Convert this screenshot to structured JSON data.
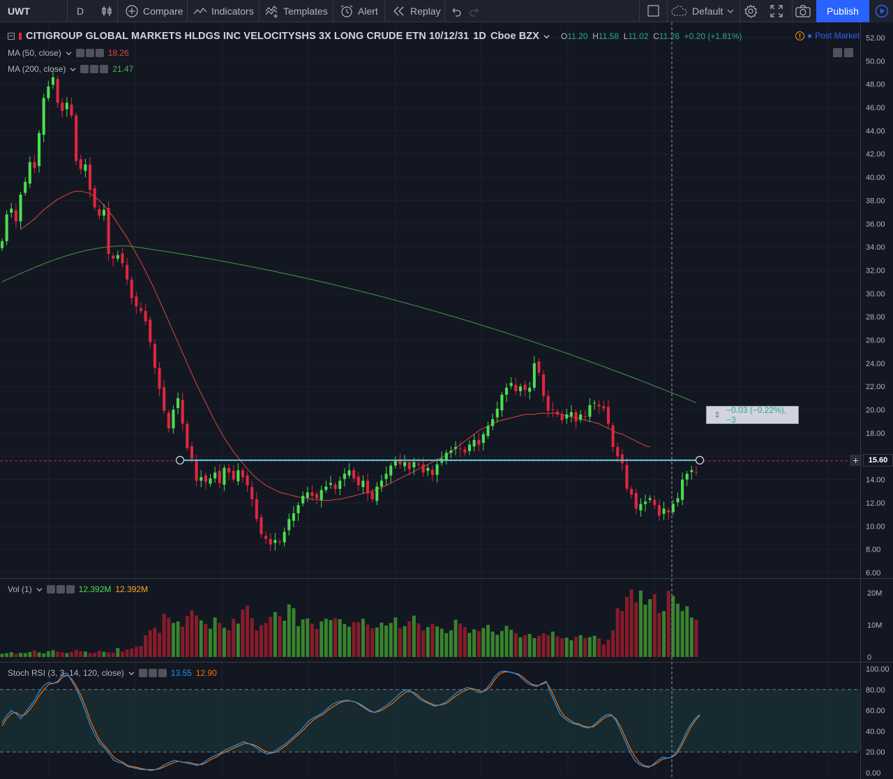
{
  "toolbar": {
    "symbol": "UWT",
    "interval": "D",
    "compare": "Compare",
    "indicators": "Indicators",
    "templates": "Templates",
    "alert": "Alert",
    "replay": "Replay",
    "layout": "Default",
    "publish": "Publish"
  },
  "main": {
    "title": "CITIGROUP GLOBAL MARKETS HLDGS INC VELOCITYSHS 3X LONG CRUDE ETN 10/12/31",
    "timeframe": "1D",
    "exchange": "Cboe BZX",
    "ohlc": {
      "o_label": "O",
      "o": "11.20",
      "h_label": "H",
      "h": "11.58",
      "l_label": "L",
      "l": "11.02",
      "c_label": "C",
      "c": "11.26",
      "change": "+0.20 (+1.81%)"
    },
    "post_market": "Post Market",
    "ma50": {
      "label": "MA (50, close)",
      "value": "18.26",
      "color": "#e0463e"
    },
    "ma200": {
      "label": "MA (200, close)",
      "value": "21.47",
      "color": "#4caf50"
    },
    "measure": "−0.03 (−0.22%), −3",
    "price_label": "15.60",
    "price_ticks": [
      "6.00",
      "8.00",
      "10.00",
      "12.00",
      "14.00",
      "16.00",
      "18.00",
      "20.00",
      "22.00",
      "24.00",
      "26.00",
      "28.00",
      "30.00",
      "32.00",
      "34.00",
      "36.00",
      "38.00",
      "40.00",
      "42.00",
      "44.00",
      "46.00",
      "48.00",
      "50.00",
      "52.00"
    ]
  },
  "volume": {
    "label": "Vol (1)",
    "v1": "12.392M",
    "v2": "12.392M",
    "ticks": [
      "0",
      "10M",
      "20M"
    ]
  },
  "stoch": {
    "label": "Stoch RSI (3, 3, 14, 120, close)",
    "k": "13.55",
    "d": "12.90",
    "ticks": [
      "0.00",
      "20.00",
      "40.00",
      "60.00",
      "80.00",
      "100.00"
    ]
  },
  "colors": {
    "up": "#26a69a",
    "up_candle": "#4ade4f",
    "down": "#e0263e",
    "k_line": "#2196f3",
    "d_line": "#ff6d00",
    "bg": "#131722"
  },
  "chart_data": {
    "type": "candlestick",
    "y_range": [
      5.5,
      53
    ],
    "closes": [
      34.5,
      36.8,
      37.3,
      36.2,
      38.5,
      39.6,
      41.3,
      40.8,
      43.8,
      46.8,
      47.8,
      48.6,
      46.4,
      45.7,
      46.4,
      45.3,
      41.4,
      40.7,
      41.1,
      38.9,
      37.4,
      36.7,
      37.2,
      33.4,
      33.0,
      33.3,
      32.6,
      31.2,
      29.6,
      28.9,
      28.5,
      27.6,
      25.8,
      23.6,
      21.8,
      19.9,
      18.4,
      20.0,
      21.0,
      18.8,
      16.7,
      15.8,
      13.9,
      14.2,
      13.8,
      14.1,
      14.6,
      13.7,
      15.0,
      14.6,
      14.0,
      14.8,
      14.2,
      13.5,
      12.3,
      10.6,
      9.3,
      8.9,
      8.4,
      8.8,
      8.6,
      9.5,
      10.6,
      11.1,
      11.8,
      12.6,
      12.9,
      12.6,
      12.4,
      13.1,
      13.4,
      13.7,
      13.2,
      13.9,
      14.5,
      14.8,
      14.1,
      13.5,
      13.9,
      12.8,
      12.3,
      13.4,
      13.9,
      14.5,
      15.2,
      15.6,
      15.3,
      15.5,
      14.9,
      15.5,
      15.3,
      14.6,
      15.0,
      14.4,
      15.3,
      15.8,
      16.3,
      16.5,
      16.8,
      16.6,
      16.3,
      17.0,
      17.4,
      17.0,
      17.9,
      18.6,
      19.2,
      20.1,
      21.3,
      21.9,
      22.3,
      21.6,
      22.0,
      21.7,
      21.9,
      24.0,
      23.2,
      21.2,
      19.9,
      20.0,
      19.6,
      19.1,
      19.6,
      19.8,
      19.0,
      19.6,
      19.4,
      20.4,
      20.6,
      20.3,
      20.1,
      18.8,
      16.8,
      16.0,
      15.4,
      13.2,
      12.7,
      11.5,
      11.9,
      12.1,
      12.4,
      11.8,
      10.9,
      11.5,
      11.2,
      11.9,
      12.4,
      14.0,
      14.5,
      14.8,
      14.6
    ],
    "ma50": [
      null,
      null,
      null,
      null,
      35.5,
      35.8,
      36.1,
      36.4,
      36.8,
      37.2,
      37.5,
      37.8,
      38.1,
      38.3,
      38.5,
      38.7,
      38.8,
      38.8,
      38.7,
      38.6,
      38.3,
      38.0,
      37.6,
      37.1,
      36.6,
      36.0,
      35.4,
      34.8,
      34.1,
      33.4,
      32.7,
      31.9,
      31.1,
      30.3,
      29.4,
      28.5,
      27.6,
      26.7,
      25.8,
      24.9,
      24.0,
      23.1,
      22.2,
      21.4,
      20.6,
      19.8,
      19.0,
      18.3,
      17.6,
      17.0,
      16.4,
      15.9,
      15.4,
      14.9,
      14.5,
      14.1,
      13.8,
      13.5,
      13.3,
      13.1,
      12.9,
      12.8,
      12.7,
      12.6,
      12.5,
      12.4,
      12.4,
      12.3,
      12.3,
      12.2,
      12.2,
      12.2,
      12.3,
      12.3,
      12.4,
      12.5,
      12.6,
      12.7,
      12.8,
      12.9,
      13.0,
      13.2,
      13.3,
      13.5,
      13.7,
      13.9,
      14.1,
      14.3,
      14.5,
      14.7,
      14.9,
      15.1,
      15.3,
      15.5,
      15.7,
      15.9,
      16.1,
      16.4,
      16.7,
      17.0,
      17.3,
      17.6,
      17.9,
      18.2,
      18.4,
      18.6,
      18.8,
      19.0,
      19.1,
      19.2,
      19.3,
      19.4,
      19.5,
      19.6,
      19.6,
      19.6,
      19.7,
      19.7,
      19.7,
      19.7,
      19.7,
      19.6,
      19.5,
      19.4,
      19.3,
      19.2,
      19.1,
      19.0,
      18.9,
      18.8,
      18.6,
      18.4,
      18.2,
      18.0,
      17.9,
      17.7,
      17.5,
      17.3,
      17.1,
      16.9,
      16.8
    ],
    "ma200_start": 31.0,
    "ma200_peak": 34.1,
    "ma200_end": 20.6,
    "volume": [
      1,
      1.2,
      1.5,
      1,
      1.3,
      1.2,
      1.5,
      2,
      1.4,
      1.1,
      1.8,
      2.1,
      1.6,
      1.4,
      1.2,
      1.5,
      2.2,
      1.8,
      1.7,
      1.2,
      1.3,
      1.9,
      1.6,
      1.4,
      1.3,
      2.8,
      1.7,
      2.3,
      2.6,
      3.1,
      3.4,
      6.8,
      8.3,
      9.1,
      7.5,
      13.5,
      12.2,
      10.6,
      11.1,
      9.4,
      12.7,
      14.5,
      12.9,
      11.4,
      10.2,
      8.8,
      12.3,
      10.6,
      9.1,
      8.3,
      11.9,
      10.4,
      14.8,
      16.0,
      12.1,
      8.3,
      9.9,
      10.6,
      12.5,
      14.0,
      12.7,
      11.3,
      16.4,
      15.2,
      9.6,
      11.7,
      12.0,
      10.4,
      8.7,
      11.1,
      11.9,
      11.5,
      12.1,
      11.8,
      10.3,
      9.4,
      10.9,
      10.8,
      11.9,
      10.1,
      8.9,
      9.2,
      10.7,
      9.8,
      10.6,
      12.3,
      9.0,
      9.6,
      11.1,
      12.9,
      10.5,
      8.2,
      9.3,
      10.3,
      9.5,
      8.8,
      7.4,
      8.3,
      11.6,
      10.4,
      9.3,
      7.5,
      8.6,
      8.1,
      9.0,
      10.0,
      7.9,
      6.9,
      8.1,
      9.7,
      8.5,
      7.4,
      6.1,
      6.8,
      7.2,
      5.9,
      6.6,
      7.4,
      6.8,
      7.9,
      6.4,
      5.8,
      6.0,
      5.2,
      6.3,
      6.8,
      5.9,
      6.2,
      6.6,
      5.8,
      3.9,
      5.4,
      8.3,
      15.2,
      14.3,
      18.7,
      21.1,
      17.0,
      20.7,
      16.3,
      18.0,
      19.6,
      13.7,
      14.3,
      20.6,
      19.1,
      16.6,
      14.3,
      15.8,
      12.3,
      11.6
    ],
    "stoch_k": [
      48,
      55,
      60,
      57,
      52,
      58,
      64,
      70,
      78,
      84,
      87,
      86,
      88,
      95,
      96,
      88,
      80,
      70,
      58,
      45,
      36,
      28,
      24,
      18,
      12,
      10,
      9,
      6,
      5,
      4,
      3,
      3,
      2,
      3,
      5,
      8,
      10,
      12,
      11,
      10,
      9,
      8,
      7,
      9,
      12,
      15,
      17,
      19,
      22,
      24,
      26,
      28,
      30,
      28,
      26,
      23,
      20,
      18,
      19,
      22,
      25,
      28,
      32,
      36,
      40,
      45,
      50,
      53,
      55,
      58,
      62,
      66,
      68,
      69,
      70,
      69,
      68,
      65,
      62,
      59,
      58,
      60,
      63,
      66,
      70,
      74,
      78,
      80,
      78,
      74,
      70,
      68,
      66,
      64,
      65,
      67,
      70,
      74,
      78,
      80,
      82,
      81,
      78,
      77,
      80,
      86,
      93,
      97,
      98,
      97,
      96,
      94,
      90,
      86,
      84,
      83,
      86,
      88,
      76,
      66,
      56,
      52,
      49,
      47,
      46,
      44,
      43,
      45,
      49,
      53,
      56,
      56,
      50,
      40,
      30,
      20,
      12,
      8,
      6,
      5,
      8,
      12,
      15,
      14,
      15,
      20,
      28,
      38,
      46,
      52,
      56
    ],
    "stoch_d": [
      45,
      52,
      57,
      58,
      55,
      56,
      61,
      67,
      74,
      80,
      85,
      86,
      87,
      92,
      94,
      90,
      83,
      74,
      63,
      50,
      40,
      31,
      26,
      21,
      15,
      12,
      10,
      7,
      6,
      5,
      4,
      3,
      3,
      3,
      4,
      6,
      8,
      10,
      11,
      10,
      10,
      9,
      8,
      8,
      10,
      13,
      15,
      18,
      20,
      22,
      24,
      26,
      28,
      28,
      27,
      25,
      22,
      20,
      19,
      20,
      23,
      26,
      30,
      34,
      38,
      42,
      47,
      51,
      54,
      56,
      60,
      63,
      66,
      68,
      69,
      69,
      68,
      66,
      63,
      60,
      58,
      59,
      61,
      64,
      67,
      71,
      75,
      78,
      78,
      76,
      72,
      69,
      67,
      65,
      65,
      66,
      68,
      72,
      75,
      78,
      80,
      81,
      80,
      78,
      79,
      83,
      90,
      95,
      97,
      97,
      96,
      95,
      92,
      88,
      85,
      84,
      85,
      87,
      80,
      70,
      60,
      54,
      51,
      48,
      47,
      45,
      44,
      44,
      47,
      51,
      54,
      55,
      52,
      44,
      34,
      24,
      16,
      10,
      7,
      6,
      7,
      10,
      13,
      14,
      15,
      18,
      25,
      34,
      43,
      50,
      55
    ]
  }
}
